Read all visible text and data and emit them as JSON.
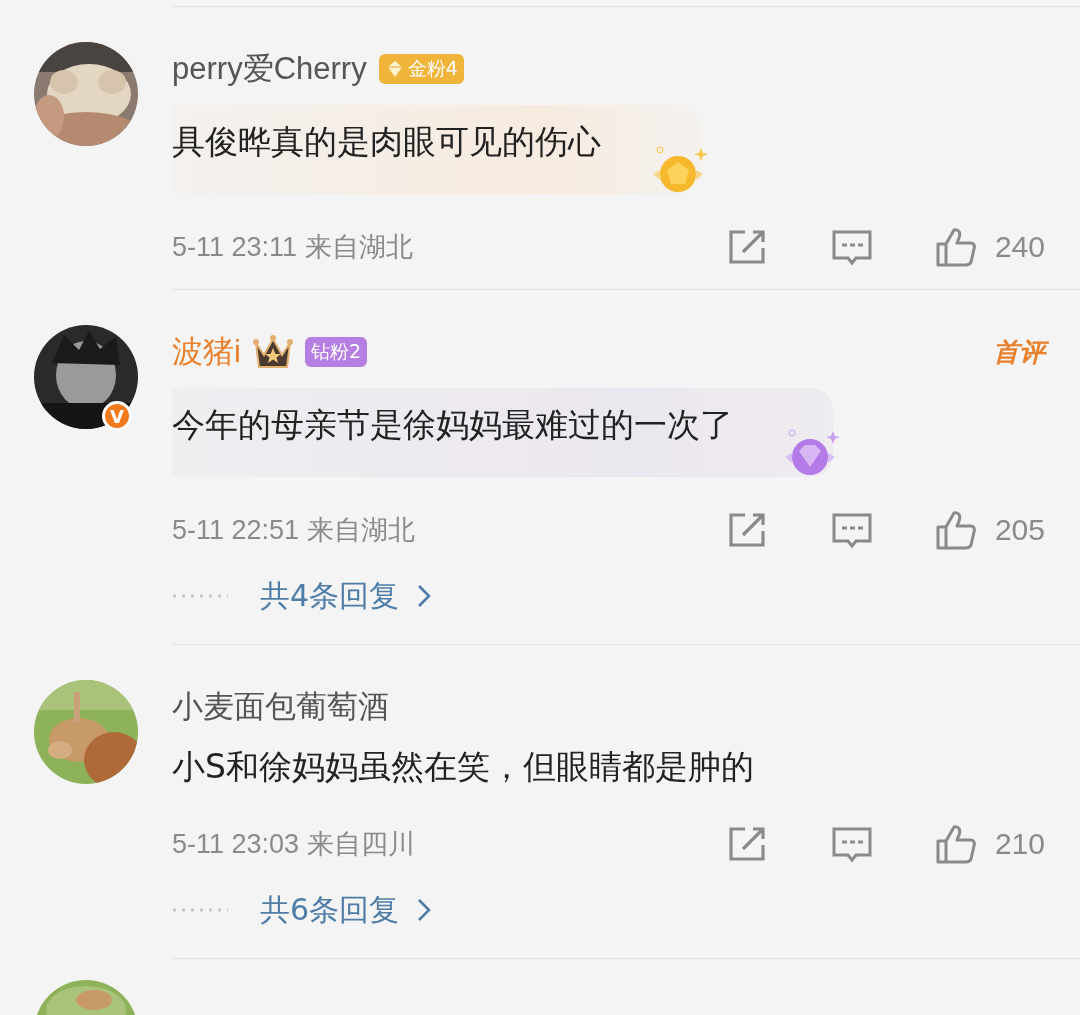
{
  "comments": [
    {
      "name": "perry爱Cherry",
      "vip": false,
      "fan_badge": {
        "kind": "gold",
        "label": "金粉4"
      },
      "bubble": {
        "kind": "gold"
      },
      "text": "具俊晔真的是肉眼可见的伤心",
      "time": "5-11 23:11",
      "location": "来自湖北",
      "likes": "240"
    },
    {
      "verified_mark": "V",
      "name": "波猪i",
      "vip": true,
      "fan_badge": {
        "kind": "diamond",
        "label": "钻粉2"
      },
      "tag": "首评",
      "bubble": {
        "kind": "diamond"
      },
      "text": "今年的母亲节是徐妈妈最难过的一次了",
      "time": "5-11 22:51",
      "location": "来自湖北",
      "likes": "205",
      "replies": "共4条回复"
    },
    {
      "name": "小麦面包葡萄酒",
      "vip": false,
      "text": "小S和徐妈妈虽然在笑，但眼睛都是肿的",
      "time": "5-11 23:03",
      "location": "来自四川",
      "likes": "210",
      "replies": "共6条回复"
    }
  ]
}
